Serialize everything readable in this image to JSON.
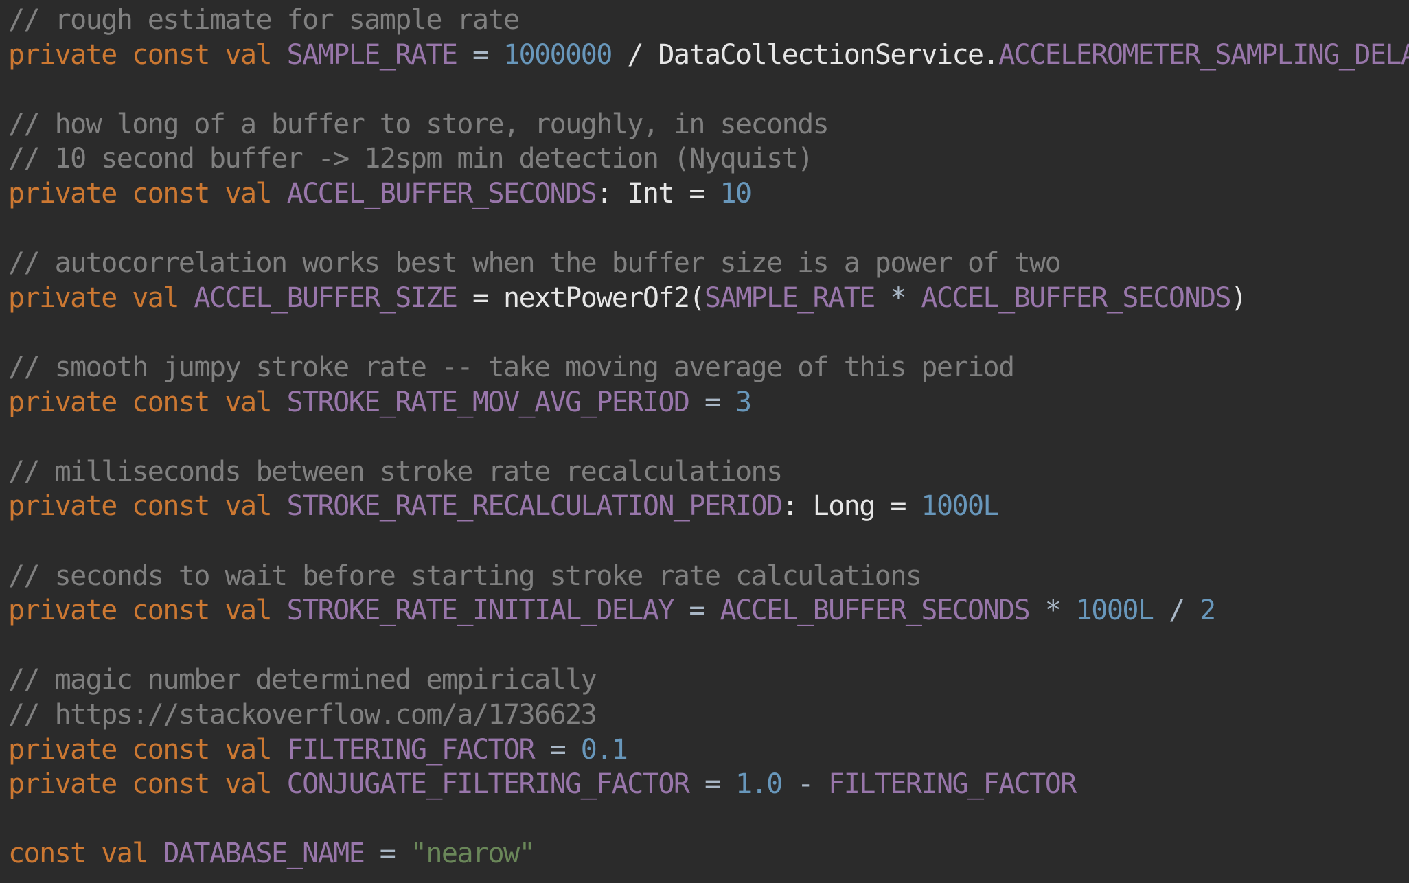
{
  "editor": {
    "lines": [
      [
        {
          "t": "// rough estimate for sample rate",
          "k": "comment"
        }
      ],
      [
        {
          "t": "private const val ",
          "k": "keyword"
        },
        {
          "t": "SAMPLE_RATE",
          "k": "const"
        },
        {
          "t": " = ",
          "k": "plain"
        },
        {
          "t": "1000000",
          "k": "number"
        },
        {
          "t": " / DataCollectionService.",
          "k": "ident"
        },
        {
          "t": "ACCELEROMETER_SAMPLING_DELAY",
          "k": "const"
        }
      ],
      [],
      [
        {
          "t": "// how long of a buffer to store, roughly, in seconds",
          "k": "comment"
        }
      ],
      [
        {
          "t": "// 10 second buffer -> 12spm min detection (Nyquist)",
          "k": "comment"
        }
      ],
      [
        {
          "t": "private const val ",
          "k": "keyword"
        },
        {
          "t": "ACCEL_BUFFER_SECONDS",
          "k": "const"
        },
        {
          "t": ": Int = ",
          "k": "ident"
        },
        {
          "t": "10",
          "k": "number"
        }
      ],
      [],
      [
        {
          "t": "// autocorrelation works best when the buffer size is a power of two",
          "k": "comment"
        }
      ],
      [
        {
          "t": "private val ",
          "k": "keyword"
        },
        {
          "t": "ACCEL_BUFFER_SIZE",
          "k": "const"
        },
        {
          "t": " = nextPowerOf2(",
          "k": "ident"
        },
        {
          "t": "SAMPLE_RATE",
          "k": "const"
        },
        {
          "t": " * ",
          "k": "plain"
        },
        {
          "t": "ACCEL_BUFFER_SECONDS",
          "k": "const"
        },
        {
          "t": ")",
          "k": "ident"
        }
      ],
      [],
      [
        {
          "t": "// smooth jumpy stroke rate -- take moving average of this period",
          "k": "comment"
        }
      ],
      [
        {
          "t": "private const val ",
          "k": "keyword"
        },
        {
          "t": "STROKE_RATE_MOV_AVG_PERIOD",
          "k": "const"
        },
        {
          "t": " = ",
          "k": "plain"
        },
        {
          "t": "3",
          "k": "number"
        }
      ],
      [],
      [
        {
          "t": "// milliseconds between stroke rate recalculations",
          "k": "comment"
        }
      ],
      [
        {
          "t": "private const val ",
          "k": "keyword"
        },
        {
          "t": "STROKE_RATE_RECALCULATION_PERIOD",
          "k": "const"
        },
        {
          "t": ": Long = ",
          "k": "ident"
        },
        {
          "t": "1000L",
          "k": "number"
        }
      ],
      [],
      [
        {
          "t": "// seconds to wait before starting stroke rate calculations",
          "k": "comment"
        }
      ],
      [
        {
          "t": "private const val ",
          "k": "keyword"
        },
        {
          "t": "STROKE_RATE_INITIAL_DELAY",
          "k": "const"
        },
        {
          "t": " = ",
          "k": "plain"
        },
        {
          "t": "ACCEL_BUFFER_SECONDS",
          "k": "const"
        },
        {
          "t": " * ",
          "k": "plain"
        },
        {
          "t": "1000L",
          "k": "number"
        },
        {
          "t": " / ",
          "k": "plain"
        },
        {
          "t": "2",
          "k": "number"
        }
      ],
      [],
      [
        {
          "t": "// magic number determined empirically",
          "k": "comment"
        }
      ],
      [
        {
          "t": "// https://stackoverflow.com/a/1736623",
          "k": "comment"
        }
      ],
      [
        {
          "t": "private const val ",
          "k": "keyword"
        },
        {
          "t": "FILTERING_FACTOR",
          "k": "const"
        },
        {
          "t": " = ",
          "k": "plain"
        },
        {
          "t": "0.1",
          "k": "number"
        }
      ],
      [
        {
          "t": "private const val ",
          "k": "keyword"
        },
        {
          "t": "CONJUGATE_FILTERING_FACTOR",
          "k": "const"
        },
        {
          "t": " = ",
          "k": "plain"
        },
        {
          "t": "1.0",
          "k": "number"
        },
        {
          "t": " - ",
          "k": "plain"
        },
        {
          "t": "FILTERING_FACTOR",
          "k": "const"
        }
      ],
      [],
      [
        {
          "t": "const val ",
          "k": "keyword"
        },
        {
          "t": "DATABASE_NAME",
          "k": "const"
        },
        {
          "t": " = ",
          "k": "plain"
        },
        {
          "t": "\"nearow\"",
          "k": "string"
        }
      ]
    ]
  },
  "colors": {
    "background": "#2b2b2b",
    "keyword": "#cc7832",
    "constant": "#9876aa",
    "number": "#6897bb",
    "string": "#6a8759",
    "comment": "#808080",
    "text": "#a9b7c6"
  }
}
